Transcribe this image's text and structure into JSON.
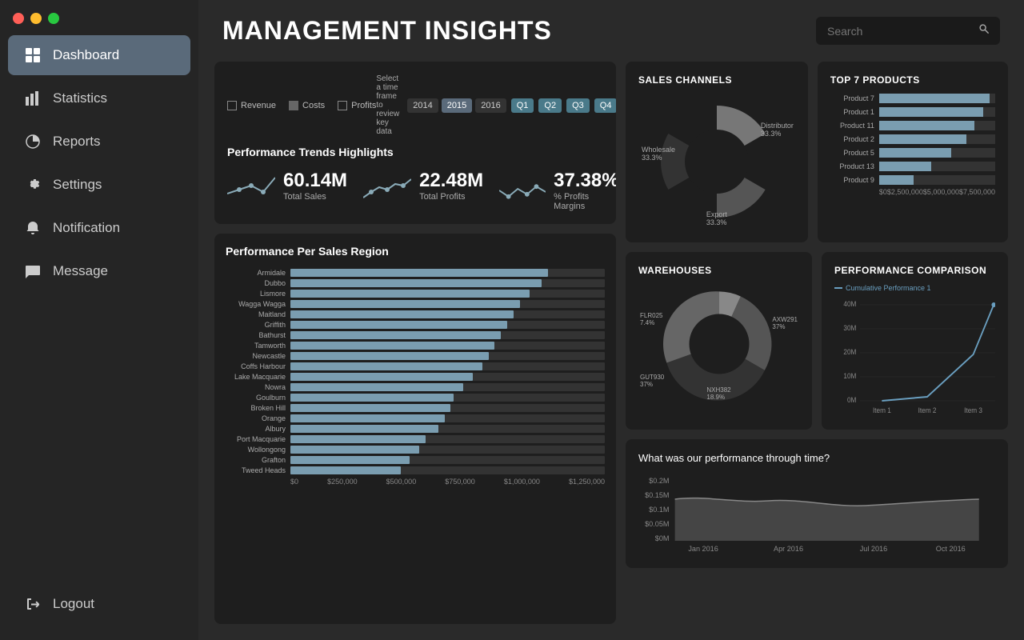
{
  "sidebar": {
    "nav_items": [
      {
        "id": "dashboard",
        "label": "Dashboard",
        "active": true,
        "icon": "grid"
      },
      {
        "id": "statistics",
        "label": "Statistics",
        "active": false,
        "icon": "bar-chart"
      },
      {
        "id": "reports",
        "label": "Reports",
        "active": false,
        "icon": "pie-chart"
      },
      {
        "id": "settings",
        "label": "Settings",
        "active": false,
        "icon": "gear"
      },
      {
        "id": "notification",
        "label": "Notification",
        "active": false,
        "icon": "bell"
      },
      {
        "id": "message",
        "label": "Message",
        "active": false,
        "icon": "message"
      }
    ],
    "logout_label": "Logout"
  },
  "header": {
    "title": "MANAGEMENT INSIGHTS",
    "search_placeholder": "Search"
  },
  "performance_trends": {
    "title": "Performance Trends Highlights",
    "subtitle": "Select a time frame to review key data",
    "legend": [
      {
        "label": "Revenue",
        "filled": false
      },
      {
        "label": "Costs",
        "filled": true
      },
      {
        "label": "Profits",
        "filled": false
      }
    ],
    "years": [
      "2014",
      "2015",
      "2016"
    ],
    "quarters": [
      "Q1",
      "Q2",
      "Q3",
      "Q4"
    ],
    "metrics": [
      {
        "value": "60.14M",
        "label": "Total Sales"
      },
      {
        "value": "22.48M",
        "label": "Total Profits"
      },
      {
        "value": "37.38%",
        "label": "% Profits Margins"
      }
    ]
  },
  "sales_region": {
    "title": "Performance Per Sales Region",
    "regions": [
      {
        "name": "Armidale",
        "pct": 82
      },
      {
        "name": "Dubbo",
        "pct": 80
      },
      {
        "name": "Lismore",
        "pct": 76
      },
      {
        "name": "Wagga Wagga",
        "pct": 73
      },
      {
        "name": "Maitland",
        "pct": 71
      },
      {
        "name": "Griffith",
        "pct": 69
      },
      {
        "name": "Bathurst",
        "pct": 67
      },
      {
        "name": "Tamworth",
        "pct": 65
      },
      {
        "name": "Newcastle",
        "pct": 63
      },
      {
        "name": "Coffs Harbour",
        "pct": 61
      },
      {
        "name": "Lake Macquarie",
        "pct": 58
      },
      {
        "name": "Nowra",
        "pct": 55
      },
      {
        "name": "Goulburn",
        "pct": 52
      },
      {
        "name": "Broken Hill",
        "pct": 51
      },
      {
        "name": "Orange",
        "pct": 49
      },
      {
        "name": "Albury",
        "pct": 47
      },
      {
        "name": "Port Macquarie",
        "pct": 43
      },
      {
        "name": "Wollongong",
        "pct": 41
      },
      {
        "name": "Grafton",
        "pct": 38
      },
      {
        "name": "Tweed Heads",
        "pct": 35
      }
    ],
    "x_axis": [
      "$0",
      "$250,000",
      "$500,000",
      "$750,000",
      "$1,000,000",
      "$1,250,000"
    ]
  },
  "sales_channels": {
    "title": "SALES CHANNELS",
    "segments": [
      {
        "label": "Wholesale\n33.3%",
        "color": "#888",
        "pct": 33.3,
        "position": "left"
      },
      {
        "label": "Distributor\n33.3%",
        "color": "#555",
        "pct": 33.3,
        "position": "right-top"
      },
      {
        "label": "Export\n33.3%",
        "color": "#333",
        "pct": 33.4,
        "position": "bottom"
      }
    ]
  },
  "top7_products": {
    "title": "TOP 7 PRODUCTS",
    "products": [
      {
        "name": "Product 7",
        "pct": 95
      },
      {
        "name": "Product 1",
        "pct": 90
      },
      {
        "name": "Product 11",
        "pct": 82
      },
      {
        "name": "Product 2",
        "pct": 75
      },
      {
        "name": "Product 5",
        "pct": 62
      },
      {
        "name": "Product 13",
        "pct": 45
      },
      {
        "name": "Product 9",
        "pct": 30
      }
    ],
    "x_axis": [
      "$0",
      "$2,500,000",
      "$5,000,000",
      "$7,500,000"
    ]
  },
  "warehouses": {
    "title": "WAREHOUSES",
    "segments": [
      {
        "label": "FLR025\n7.4%",
        "color": "#888",
        "pct": 7.4
      },
      {
        "label": "AXW291\n37%",
        "color": "#555",
        "pct": 37
      },
      {
        "label": "GUT930\n37%",
        "color": "#333",
        "pct": 37
      },
      {
        "label": "NXH382\n18.9%",
        "color": "#666",
        "pct": 18.9
      }
    ]
  },
  "performance_comparison": {
    "title": "PERFORMANCE COMPARISON",
    "legend": "Cumulative Performance 1",
    "y_axis": [
      "40M",
      "30M",
      "20M",
      "10M",
      "0M"
    ],
    "x_axis": [
      "Item 1",
      "Item 2",
      "Item 3"
    ],
    "data_points": [
      0,
      2,
      15,
      38
    ]
  },
  "time_performance": {
    "title": "What was our performance through time?",
    "y_axis": [
      "$0.2M",
      "$0.15M",
      "$0.1M",
      "$0.05M",
      "$0M"
    ],
    "x_axis": [
      "Jan 2016",
      "Apr 2016",
      "Jul 2016",
      "Oct 2016"
    ]
  }
}
